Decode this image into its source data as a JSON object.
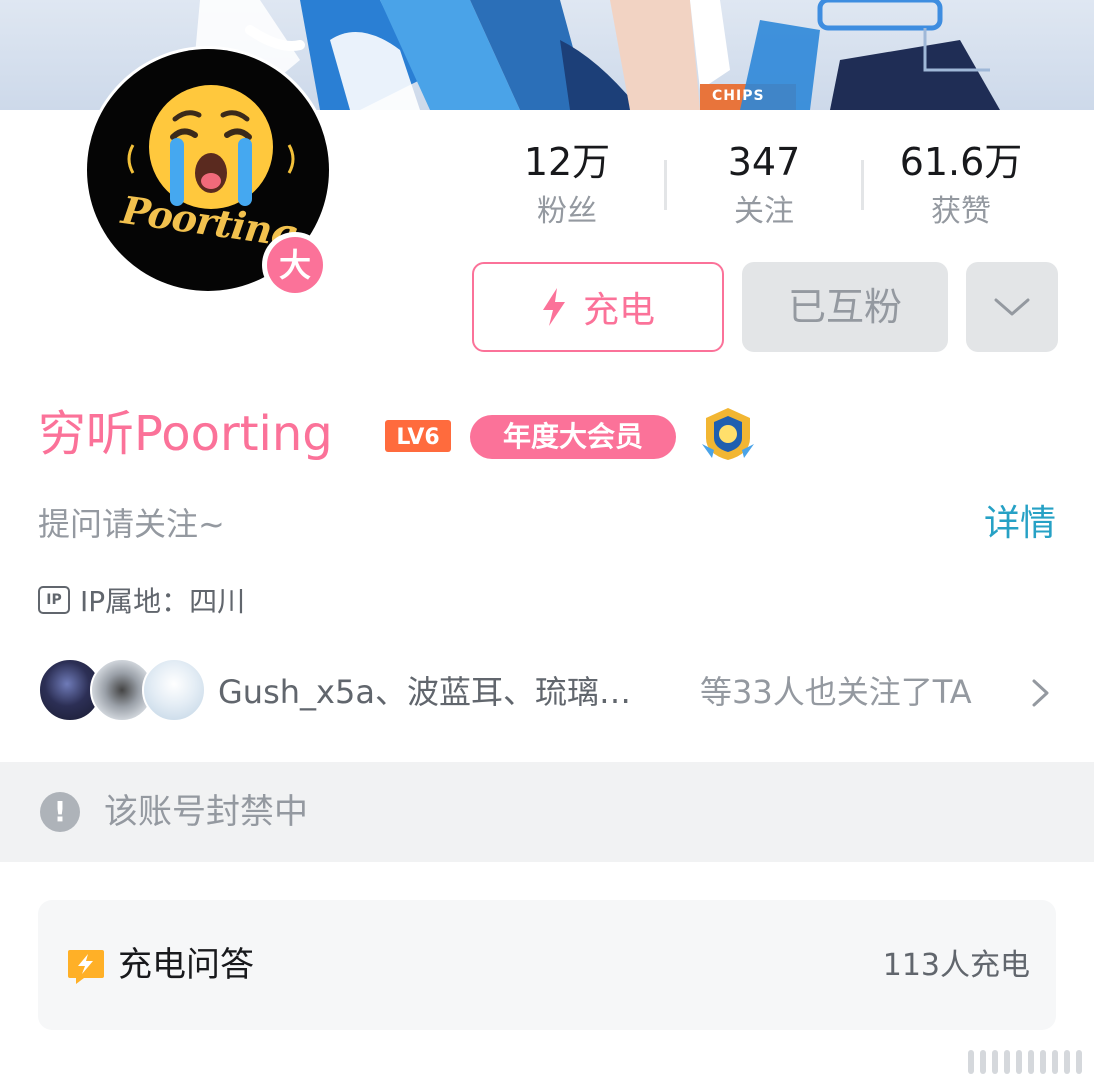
{
  "stats": [
    {
      "value": "12万",
      "label": "粉丝"
    },
    {
      "value": "347",
      "label": "关注"
    },
    {
      "value": "61.6万",
      "label": "获赞"
    }
  ],
  "avatar": {
    "badge": "大",
    "logo_text": "Poorting"
  },
  "banner": {
    "sign_text": "CHIPS"
  },
  "actions": {
    "charge_label": "充电",
    "mutual_label": "已互粉",
    "more_icon": "chevron-down-icon"
  },
  "profile": {
    "name": "穷听Poorting",
    "level": "LV6",
    "vip_label": "年度大会员",
    "bio": "提问请关注~",
    "detail_link": "详情",
    "ip_icon_text": "IP",
    "ip_location": "IP属地：四川"
  },
  "followers": {
    "names": "Gush_x5a、波蓝耳、琉璃…",
    "suffix": "等33人也关注了TA"
  },
  "notice": {
    "icon": "!",
    "text": "该账号封禁中"
  },
  "charge_qa": {
    "title": "充电问答",
    "count": "113人充电"
  },
  "colors": {
    "brand_pink": "#fb7299",
    "link_blue": "#26a1c5",
    "muted_gray": "#9499a0",
    "button_gray": "#e3e5e7",
    "qa_icon_yellow": "#ffb027"
  }
}
